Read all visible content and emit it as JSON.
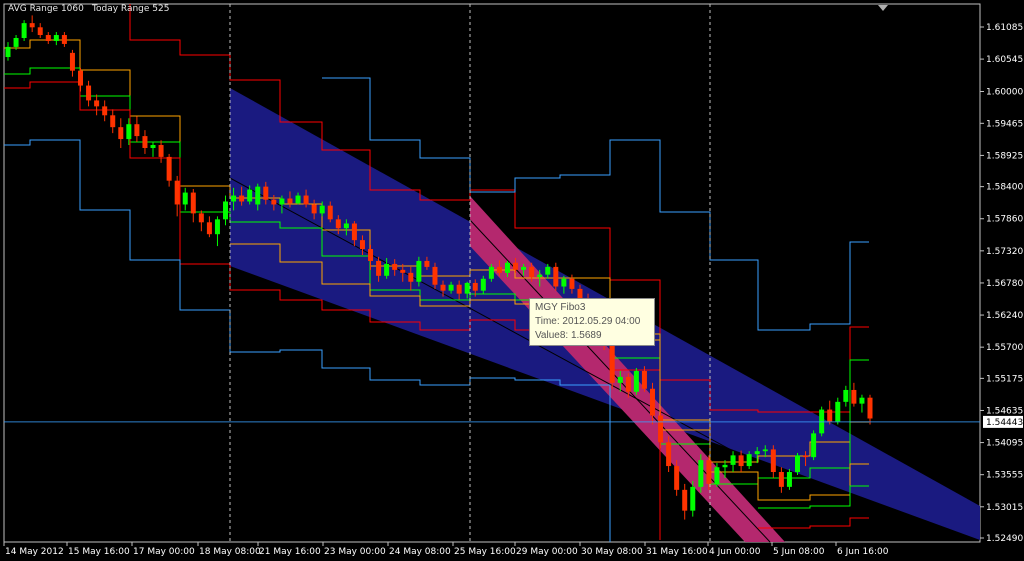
{
  "info": {
    "avg_range": "AVG Range 1060",
    "today_range": "Today Range 525"
  },
  "tooltip": {
    "title": "MGY Fibo3",
    "time": "Time: 2012.05.29 04:00",
    "value": "Value8: 1.5689"
  },
  "colors": {
    "background": "#000000",
    "grid": "#c0c0c0",
    "bull": "#00ff00",
    "bear": "#ff3300",
    "channel_blue": "#1a1a80",
    "channel_pink": "#b4286e",
    "line_red": "#ff0000",
    "line_orange": "#ffa500",
    "line_green": "#00ff00",
    "line_skyblue": "#3aa0ff"
  },
  "chart_data": {
    "type": "candlestick",
    "symbol_timeframe": "H4",
    "yaxis_labels": [
      "1.61085",
      "1.60545",
      "1.60000",
      "1.59465",
      "1.58925",
      "1.58400",
      "1.57860",
      "1.57320",
      "1.56780",
      "1.56240",
      "1.55700",
      "1.55175",
      "1.54635",
      "1.54095",
      "1.53555",
      "1.53015",
      "1.52490"
    ],
    "yaxis_values": [
      1.61085,
      1.60545,
      1.6,
      1.59465,
      1.58925,
      1.584,
      1.5786,
      1.5732,
      1.5678,
      1.5624,
      1.557,
      1.55175,
      1.54635,
      1.54095,
      1.53555,
      1.53015,
      1.5249
    ],
    "current_price": "1.54443",
    "xaxis_labels": [
      "14 May 2012",
      "15 May 16:00",
      "17 May 00:00",
      "18 May 08:00",
      "21 May 16:00",
      "23 May 00:00",
      "24 May 08:00",
      "25 May 16:00",
      "29 May 00:00",
      "30 May 08:00",
      "31 May 16:00",
      "4 Jun 00:00",
      "5 Jun 08:00",
      "6 Jun 16:00"
    ],
    "grid": "vertical session separators only",
    "candles": [
      [
        1.6058,
        1.6083,
        1.6052,
        1.6075
      ],
      [
        1.6075,
        1.6095,
        1.607,
        1.609
      ],
      [
        1.609,
        1.612,
        1.6085,
        1.6115
      ],
      [
        1.6115,
        1.6128,
        1.61,
        1.6108
      ],
      [
        1.6108,
        1.6115,
        1.609,
        1.6095
      ],
      [
        1.6095,
        1.61,
        1.608,
        1.6085
      ],
      [
        1.6085,
        1.61,
        1.6078,
        1.6095
      ],
      [
        1.6095,
        1.61,
        1.6075,
        1.608
      ],
      [
        1.6065,
        1.607,
        1.6025,
        1.6035
      ],
      [
        1.6035,
        1.604,
        1.6,
        1.601
      ],
      [
        1.601,
        1.6018,
        1.5975,
        1.5985
      ],
      [
        1.5985,
        1.5995,
        1.596,
        1.5975
      ],
      [
        1.5975,
        1.5985,
        1.595,
        1.596
      ],
      [
        1.596,
        1.597,
        1.593,
        1.594
      ],
      [
        1.594,
        1.5955,
        1.5905,
        1.592
      ],
      [
        1.592,
        1.5955,
        1.591,
        1.5945
      ],
      [
        1.5945,
        1.5958,
        1.5915,
        1.5925
      ],
      [
        1.5925,
        1.5935,
        1.5895,
        1.5905
      ],
      [
        1.5905,
        1.5915,
        1.589,
        1.591
      ],
      [
        1.591,
        1.5918,
        1.588,
        1.589
      ],
      [
        1.589,
        1.5895,
        1.584,
        1.585
      ],
      [
        1.585,
        1.5858,
        1.579,
        1.581
      ],
      [
        1.581,
        1.5838,
        1.58,
        1.583
      ],
      [
        1.583,
        1.5836,
        1.578,
        1.5795
      ],
      [
        1.5795,
        1.58,
        1.5765,
        1.578
      ],
      [
        1.578,
        1.579,
        1.5755,
        1.576
      ],
      [
        1.576,
        1.579,
        1.574,
        1.5785
      ],
      [
        1.5785,
        1.5825,
        1.5775,
        1.5815
      ],
      [
        1.5815,
        1.5838,
        1.58,
        1.5825
      ],
      [
        1.5825,
        1.584,
        1.5808,
        1.5815
      ],
      [
        1.5815,
        1.5842,
        1.581,
        1.5835
      ],
      [
        1.581,
        1.5845,
        1.58,
        1.584
      ],
      [
        1.584,
        1.5848,
        1.581,
        1.5818
      ],
      [
        1.5818,
        1.5826,
        1.58,
        1.581
      ],
      [
        1.581,
        1.5825,
        1.5795,
        1.582
      ],
      [
        1.582,
        1.5832,
        1.5805,
        1.5812
      ],
      [
        1.5812,
        1.583,
        1.581,
        1.5825
      ],
      [
        1.5825,
        1.5835,
        1.5805,
        1.581
      ],
      [
        1.581,
        1.5818,
        1.5785,
        1.5795
      ],
      [
        1.5795,
        1.5815,
        1.579,
        1.5808
      ],
      [
        1.5808,
        1.5815,
        1.578,
        1.5785
      ],
      [
        1.5785,
        1.5792,
        1.576,
        1.577
      ],
      [
        1.577,
        1.5785,
        1.5758,
        1.5778
      ],
      [
        1.5778,
        1.5782,
        1.574,
        1.575
      ],
      [
        1.575,
        1.5758,
        1.5725,
        1.5735
      ],
      [
        1.5735,
        1.5742,
        1.57,
        1.5715
      ],
      [
        1.5715,
        1.5722,
        1.568,
        1.569
      ],
      [
        1.569,
        1.572,
        1.5685,
        1.571
      ],
      [
        1.571,
        1.5718,
        1.569,
        1.57
      ],
      [
        1.57,
        1.571,
        1.568,
        1.5695
      ],
      [
        1.5695,
        1.5705,
        1.5665,
        1.568
      ],
      [
        1.568,
        1.5722,
        1.5672,
        1.5715
      ],
      [
        1.5715,
        1.5722,
        1.57,
        1.5705
      ],
      [
        1.5705,
        1.5712,
        1.5668,
        1.5675
      ],
      [
        1.5675,
        1.5682,
        1.5655,
        1.5665
      ],
      [
        1.5665,
        1.568,
        1.566,
        1.5675
      ],
      [
        1.5675,
        1.5682,
        1.565,
        1.566
      ],
      [
        1.566,
        1.568,
        1.5652,
        1.5678
      ],
      [
        1.5678,
        1.5684,
        1.5655,
        1.5665
      ],
      [
        1.5665,
        1.569,
        1.566,
        1.5685
      ],
      [
        1.5685,
        1.571,
        1.568,
        1.5705
      ],
      [
        1.5705,
        1.5716,
        1.569,
        1.5695
      ],
      [
        1.5695,
        1.5715,
        1.5688,
        1.5712
      ],
      [
        1.5712,
        1.572,
        1.5695,
        1.57
      ],
      [
        1.57,
        1.571,
        1.569,
        1.5705
      ],
      [
        1.5705,
        1.5712,
        1.568,
        1.5688
      ],
      [
        1.5688,
        1.57,
        1.5672,
        1.5692
      ],
      [
        1.5692,
        1.571,
        1.5685,
        1.5705
      ],
      [
        1.5705,
        1.5712,
        1.5665,
        1.5672
      ],
      [
        1.5672,
        1.569,
        1.566,
        1.5685
      ],
      [
        1.5685,
        1.5692,
        1.566,
        1.5668
      ],
      [
        1.5668,
        1.5675,
        1.564,
        1.565
      ],
      [
        1.565,
        1.566,
        1.563,
        1.564
      ],
      [
        1.564,
        1.5648,
        1.56,
        1.5615
      ],
      [
        1.5615,
        1.562,
        1.5565,
        1.5575
      ],
      [
        1.5575,
        1.558,
        1.55,
        1.551
      ],
      [
        1.551,
        1.553,
        1.5495,
        1.552
      ],
      [
        1.552,
        1.5526,
        1.5485,
        1.5495
      ],
      [
        1.5495,
        1.5535,
        1.549,
        1.553
      ],
      [
        1.553,
        1.5538,
        1.5495,
        1.55
      ],
      [
        1.55,
        1.551,
        1.544,
        1.5455
      ],
      [
        1.5455,
        1.5465,
        1.54,
        1.541
      ],
      [
        1.541,
        1.542,
        1.536,
        1.537
      ],
      [
        1.537,
        1.538,
        1.532,
        1.533
      ],
      [
        1.533,
        1.534,
        1.528,
        1.5295
      ],
      [
        1.5295,
        1.5345,
        1.5285,
        1.5335
      ],
      [
        1.5335,
        1.539,
        1.5325,
        1.538
      ],
      [
        1.538,
        1.5388,
        1.533,
        1.534
      ],
      [
        1.534,
        1.5375,
        1.5335,
        1.5368
      ],
      [
        1.5368,
        1.538,
        1.535,
        1.5372
      ],
      [
        1.5372,
        1.5395,
        1.536,
        1.5388
      ],
      [
        1.5388,
        1.5396,
        1.536,
        1.537
      ],
      [
        1.537,
        1.5395,
        1.5365,
        1.539
      ],
      [
        1.539,
        1.5402,
        1.5375,
        1.5395
      ],
      [
        1.5395,
        1.5405,
        1.5385,
        1.5398
      ],
      [
        1.5398,
        1.5405,
        1.535,
        1.536
      ],
      [
        1.536,
        1.5368,
        1.5325,
        1.5335
      ],
      [
        1.5335,
        1.5365,
        1.533,
        1.536
      ],
      [
        1.536,
        1.5392,
        1.5355,
        1.5388
      ],
      [
        1.5388,
        1.5395,
        1.537,
        1.5385
      ],
      [
        1.5385,
        1.543,
        1.538,
        1.5425
      ],
      [
        1.5425,
        1.547,
        1.542,
        1.5465
      ],
      [
        1.5465,
        1.548,
        1.544,
        1.5445
      ],
      [
        1.5445,
        1.5485,
        1.544,
        1.5478
      ],
      [
        1.5478,
        1.5505,
        1.547,
        1.5498
      ],
      [
        1.5498,
        1.551,
        1.547,
        1.5475
      ],
      [
        1.5475,
        1.549,
        1.546,
        1.5485
      ],
      [
        1.5485,
        1.549,
        1.544,
        1.545
      ]
    ]
  }
}
